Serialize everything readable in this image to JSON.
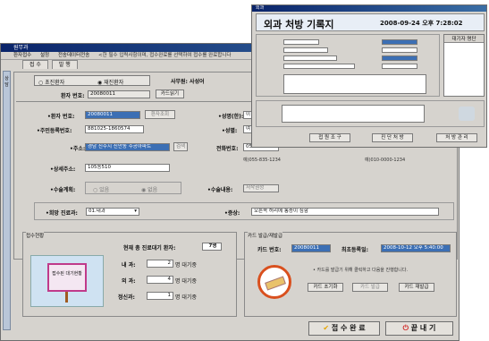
{
  "main": {
    "title": "원무과",
    "menu": [
      "환자접수",
      "설정",
      "전송데이터전송",
      "<한 필수 입력사항이며, 접수완료를 선택하여 접수를 완료합니다"
    ],
    "tabs": [
      "접 수",
      "발 행"
    ],
    "sidebar": [
      "상",
      "담"
    ],
    "radio_first": "초진환자",
    "radio_return": "재진환자",
    "officer_label": "사무원: 사성어",
    "patient_no_label": "환자 번호:",
    "patient_no_value": "20080011",
    "card_read_btn": "카드읽기",
    "f_patient_no_label": "•환자 번호:",
    "f_patient_no_value": "20080011",
    "lookup_btn": "환자조회",
    "name_label": "•성명(한):",
    "name_value": "이",
    "rrn_label": "•주민등록번호:",
    "rrn_value": "881025-1860574",
    "gender_label": "•성별:",
    "gender_value": "여",
    "address_label": "•주소:",
    "address_value": "경남 진주시 신안동 주공아파트",
    "search_btn": "검색",
    "phone_label": "전화번호:",
    "phone_value": "054-",
    "phone_example": "예)055-835-1234",
    "mobile_example": "예)010-0000-1234",
    "detail_address_label": "•상세주소:",
    "detail_address_value": "105동510",
    "surgery_plan_label": "•수술계획:",
    "surgery_yes": "있음",
    "surgery_no": "없음",
    "surgery_content_label": "•수술내용:",
    "surgery_content_value": "저작권정",
    "dept_label": "•희망 진료과:",
    "dept_value": "01.내과",
    "symptom_label": "•증상:",
    "symptom_value": "오른쪽 허리에 통증이 심함"
  },
  "status": {
    "section_title": "접수현황",
    "total_waiting_label": "현재 총 진료대기 환자:",
    "total_waiting_value": "7명",
    "board_text": "접수된 대기현황",
    "rows": [
      {
        "dept": "내 과:",
        "count": "2",
        "suffix": "명 대기중"
      },
      {
        "dept": "외 과:",
        "count": "4",
        "suffix": "명 대기중"
      },
      {
        "dept": "정신과:",
        "count": "1",
        "suffix": "명 대기중"
      }
    ]
  },
  "card": {
    "section_title": "카드 발급/재발급",
    "card_no_label": "카드 번호:",
    "card_no_value": "20080011",
    "issue_date_label": "최초등록일:",
    "issue_date_value": "2008-10-12 오후 5:40:00",
    "info_text": "• 카드를 발급기 위해 클릭하고 다음을 진행합니다.",
    "btn_init": "카드 초기화",
    "btn_issue": "카드 발급",
    "btn_reissue": "카드 재발급"
  },
  "actions": {
    "complete": "접 수 완 료",
    "close": "끝 내 기"
  },
  "surgery_window": {
    "title": "외과",
    "heading": "외과 처방 기록지",
    "datetime": "2008-09-24 오후 7:28:02",
    "waiting_list_title": "대기자 명단",
    "btn_confirm": "접 원 조 구",
    "btn_record": "진 단 처 방",
    "btn_manage": "처 방 관 리"
  }
}
